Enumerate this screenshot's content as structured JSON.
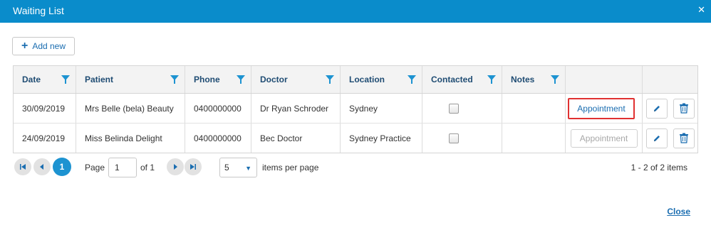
{
  "dialog": {
    "title": "Waiting List",
    "close_icon": "close-icon"
  },
  "toolbar": {
    "add_label": "Add new"
  },
  "columns": [
    "Date",
    "Patient",
    "Phone",
    "Doctor",
    "Location",
    "Contacted",
    "Notes"
  ],
  "rows": [
    {
      "date": "30/09/2019",
      "patient": "Mrs Belle (bela) Beauty",
      "phone": "0400000000",
      "doctor": "Dr Ryan Schroder",
      "location": "Sydney",
      "contacted": false,
      "notes": "",
      "action": "Appointment"
    },
    {
      "date": "24/09/2019",
      "patient": "Miss Belinda Delight",
      "phone": "0400000000",
      "doctor": "Bec Doctor",
      "location": "Sydney Practice",
      "contacted": false,
      "notes": "",
      "action": "Appointment"
    }
  ],
  "pager": {
    "current_page": "1",
    "page_label": "Page",
    "page_input": "1",
    "of_label": "of 1",
    "page_size": "5",
    "per_page_label": "items per page",
    "summary": "1 - 2 of 2 items"
  },
  "footer": {
    "close_label": "Close"
  },
  "colors": {
    "titlebar": "#0a8ccb",
    "accent": "#1a6db0",
    "current_page": "#1d93d1",
    "highlight": "#e03131"
  }
}
